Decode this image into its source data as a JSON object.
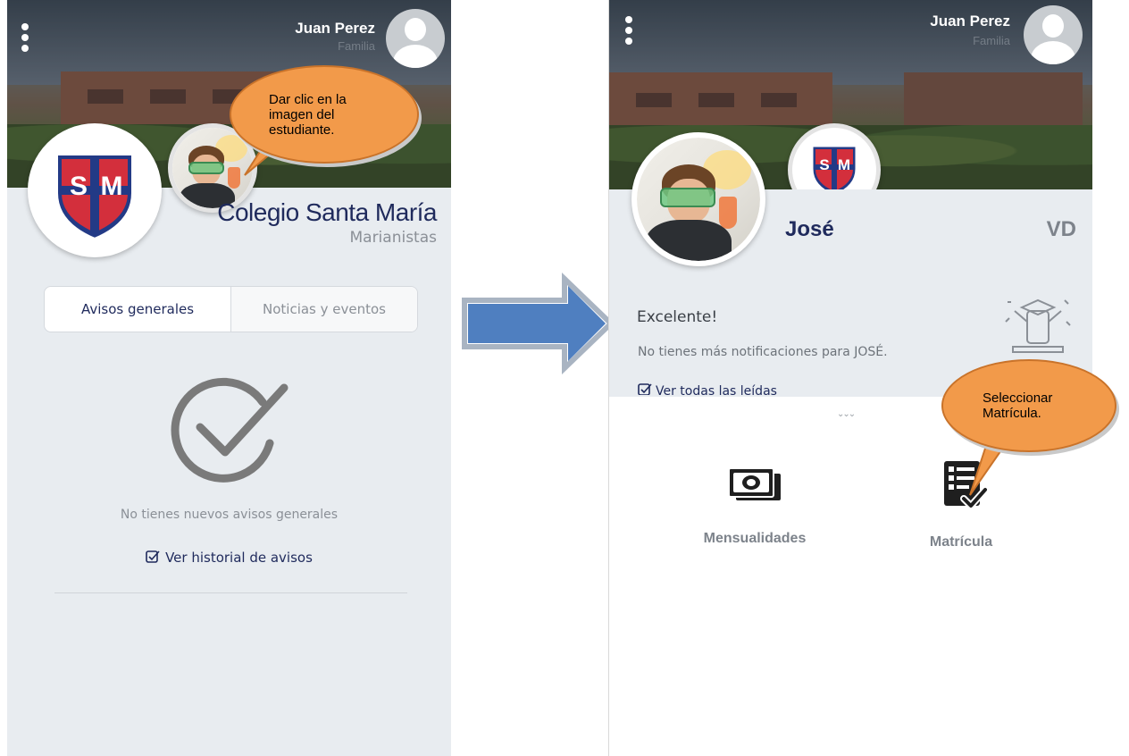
{
  "left_screen": {
    "user": {
      "name": "Juan Perez",
      "role": "Familia"
    },
    "school": {
      "name": "Colegio Santa María",
      "subtitle": "Marianistas"
    },
    "shield_letters": "S M",
    "tabs": [
      {
        "label": "Avisos generales",
        "active": true
      },
      {
        "label": "Noticias y eventos",
        "active": false
      }
    ],
    "empty_state": {
      "icon": "check-circle-icon",
      "message": "No tienes nuevos avisos generales"
    },
    "history_link": "Ver historial de avisos",
    "annotation": "Dar clic en la imagen del estudiante."
  },
  "right_screen": {
    "user": {
      "name": "Juan Perez",
      "role": "Familia"
    },
    "student": {
      "name": "José",
      "initials": "VD"
    },
    "notification": {
      "title": "Excelente!",
      "message": "No tienes más notificaciones para JOSÉ.",
      "read_link": "Ver todas las leídas"
    },
    "options": [
      {
        "label": "Mensualidades",
        "icon": "money-bills-icon"
      },
      {
        "label": "Matrícula",
        "icon": "enrollment-checklist-icon"
      }
    ],
    "annotation": "Seleccionar Matrícula."
  },
  "arrow": {
    "icon": "right-arrow-icon"
  },
  "colors": {
    "brand_navy": "#1f2a5c",
    "shield_red": "#d32f3c",
    "shield_blue": "#233a86",
    "annotation_orange": "#f29a4a",
    "arrow_blue": "#4f7fc0"
  }
}
